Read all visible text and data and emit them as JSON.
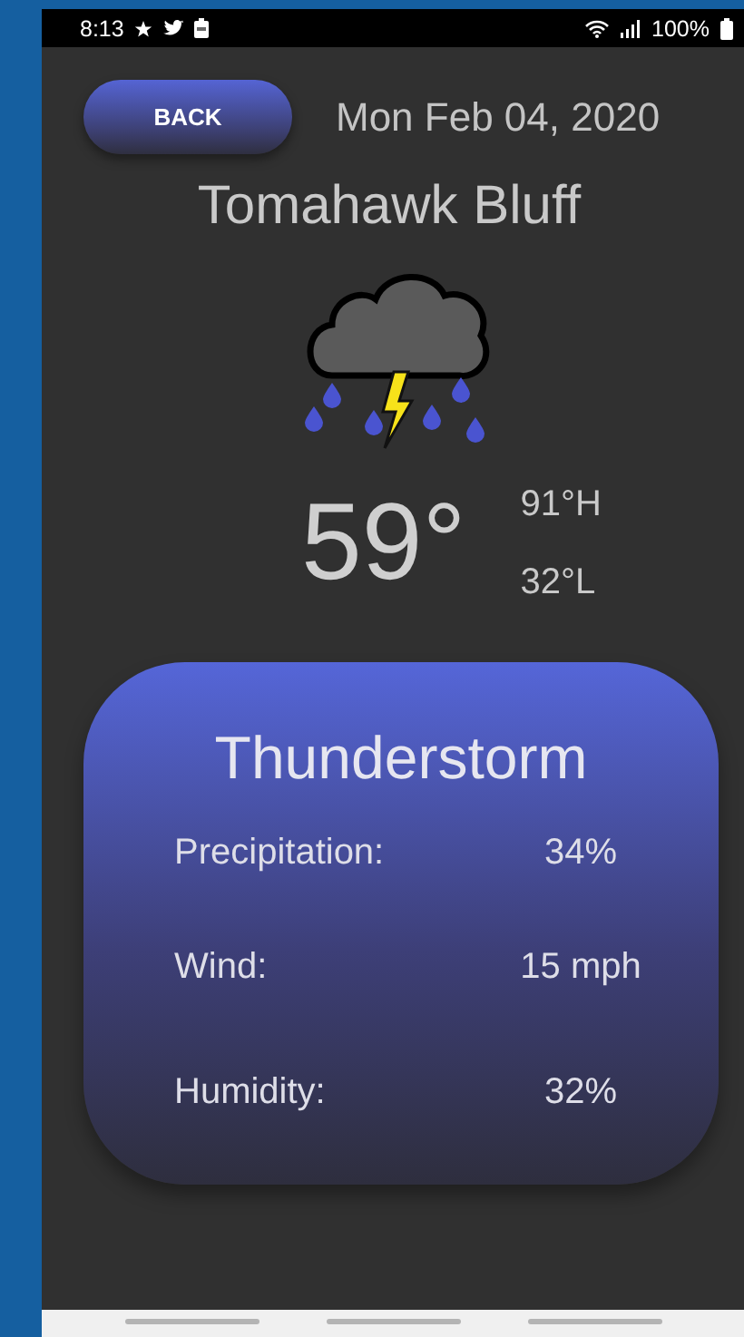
{
  "status_bar": {
    "time": "8:13",
    "battery": "100%"
  },
  "back_button": "BACK",
  "date": "Mon Feb 04, 2020",
  "city": "Tomahawk Bluff",
  "temperature": "59°",
  "high": "91°H",
  "low": "32°L",
  "card": {
    "condition": "Thunderstorm",
    "details": [
      {
        "label": "Precipitation:",
        "value": "34%"
      },
      {
        "label": "Wind:",
        "value": "15 mph"
      },
      {
        "label": "Humidity:",
        "value": "32%"
      }
    ]
  }
}
